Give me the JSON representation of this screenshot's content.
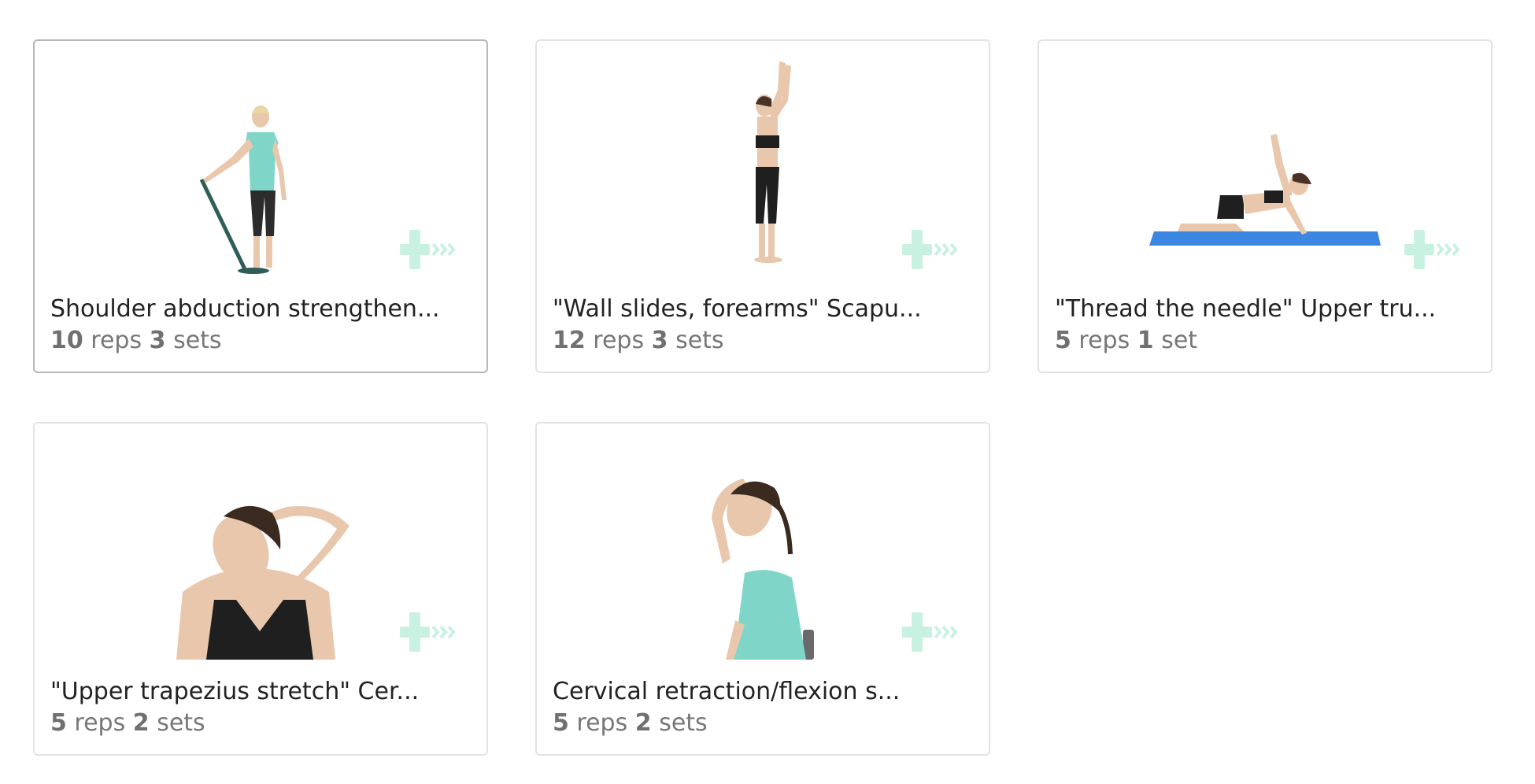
{
  "colors": {
    "card_border": "#e3e3e3",
    "card_border_hover": "#b7b7b7",
    "title_text": "#222222",
    "meta_text": "#777777",
    "logo_mint": "#c8f1e2",
    "shirt_teal": "#7fd6c8",
    "mat_blue": "#3a86e0"
  },
  "cards": [
    {
      "title": "Shoulder abduction strengthen...",
      "reps": "10",
      "reps_label": "reps",
      "sets": "3",
      "sets_label": "sets",
      "image_icon": "standing-band-exercise-figure"
    },
    {
      "title": "\"Wall slides, forearms\" Scapu...",
      "reps": "12",
      "reps_label": "reps",
      "sets": "3",
      "sets_label": "sets",
      "image_icon": "standing-arms-raised-figure"
    },
    {
      "title": "\"Thread the needle\" Upper tru...",
      "reps": "5",
      "reps_label": "reps",
      "sets": "1",
      "sets_label": "set",
      "image_icon": "kneeling-on-mat-figure"
    },
    {
      "title": "\"Upper trapezius stretch\" Cer...",
      "reps": "5",
      "reps_label": "reps",
      "sets": "2",
      "sets_label": "sets",
      "image_icon": "neck-stretch-figure"
    },
    {
      "title": "Cervical retraction/flexion s...",
      "reps": "5",
      "reps_label": "reps",
      "sets": "2",
      "sets_label": "sets",
      "image_icon": "seated-neck-flexion-figure"
    }
  ]
}
